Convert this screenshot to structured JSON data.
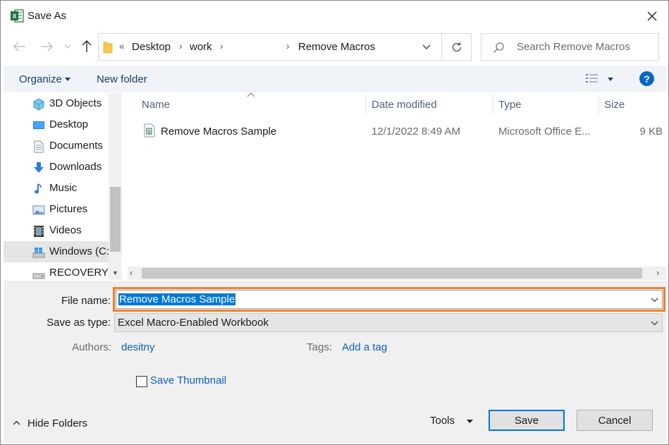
{
  "window": {
    "title": "Save As",
    "app_icon": "excel-icon",
    "accent": "#0078d7",
    "highlight": "#f0802e"
  },
  "address": {
    "overflow": "«",
    "crumbs": [
      "Desktop",
      "work",
      "Remove Macros"
    ],
    "search_placeholder": "Search Remove Macros"
  },
  "toolbar": {
    "organize": "Organize",
    "new_folder": "New folder",
    "help": "?"
  },
  "sidebar": {
    "items": [
      {
        "label": "3D Objects",
        "icon": "cube-icon"
      },
      {
        "label": "Desktop",
        "icon": "desktop-icon"
      },
      {
        "label": "Documents",
        "icon": "document-icon"
      },
      {
        "label": "Downloads",
        "icon": "download-icon"
      },
      {
        "label": "Music",
        "icon": "music-icon"
      },
      {
        "label": "Pictures",
        "icon": "picture-icon"
      },
      {
        "label": "Videos",
        "icon": "video-icon"
      },
      {
        "label": "Windows (C:",
        "icon": "windows-drive-icon"
      },
      {
        "label": "RECOVERY (",
        "icon": "drive-icon"
      }
    ]
  },
  "files": {
    "columns": [
      "Name",
      "Date modified",
      "Type",
      "Size"
    ],
    "rows": [
      {
        "name": "Remove Macros Sample",
        "date": "12/1/2022 8:49 AM",
        "type": "Microsoft Office E...",
        "size": "9 KB"
      }
    ]
  },
  "form": {
    "file_name_label": "File name:",
    "file_name_value": "Remove Macros Sample",
    "save_type_label": "Save as type:",
    "save_type_value": "Excel Macro-Enabled Workbook",
    "authors_label": "Authors:",
    "authors_value": "desitny",
    "tags_label": "Tags:",
    "tags_value": "Add a tag",
    "thumbnail_label": "Save Thumbnail",
    "thumbnail_checked": false
  },
  "footer": {
    "hide_folders": "Hide Folders",
    "tools": "Tools",
    "save": "Save",
    "cancel": "Cancel"
  }
}
